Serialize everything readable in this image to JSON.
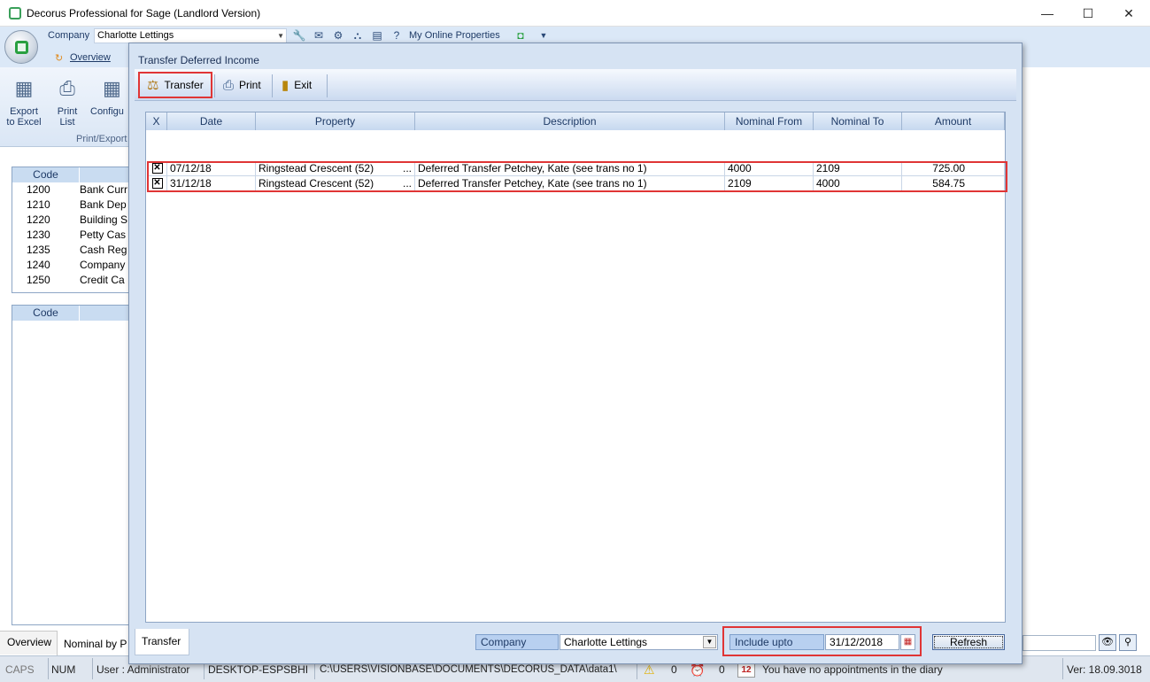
{
  "window": {
    "title": "Decorus Professional  for Sage (Landlord Version)",
    "min": "—",
    "max": "☐",
    "close": "✕"
  },
  "ribbon": {
    "company_label": "Company",
    "company_value": "Charlotte Lettings",
    "online_properties": "My Online Properties",
    "overview_tab": "Overview",
    "buttons": [
      {
        "label": "Export\nto Excel"
      },
      {
        "label": "Print\nList"
      },
      {
        "label": "Configu"
      }
    ],
    "group_label": "Print/Export"
  },
  "bg_list1": {
    "headers": [
      "Code",
      ""
    ],
    "rows": [
      {
        "code": "1200",
        "name": "Bank Curr"
      },
      {
        "code": "1210",
        "name": "Bank Dep"
      },
      {
        "code": "1220",
        "name": "Building S"
      },
      {
        "code": "1230",
        "name": "Petty Cas"
      },
      {
        "code": "1235",
        "name": "Cash Reg"
      },
      {
        "code": "1240",
        "name": "Company"
      },
      {
        "code": "1250",
        "name": "Credit Ca"
      }
    ]
  },
  "bg_list2": {
    "headers": [
      "Code",
      ""
    ]
  },
  "bottom_tabs": [
    "Overview",
    "Nominal by P"
  ],
  "dialog": {
    "title": "Transfer Deferred Income",
    "toolbar": {
      "transfer": "Transfer",
      "print": "Print",
      "exit": "Exit"
    },
    "columns": [
      "X",
      "Date",
      "Property",
      "Description",
      "Nominal From",
      "Nominal To",
      "Amount"
    ],
    "rows": [
      {
        "checked": "✕",
        "date": "07/12/18",
        "property": "Ringstead Crescent (52)",
        "ellipsis": "...",
        "description": "Deferred Transfer Petchey, Kate (see trans no 1)",
        "nominal_from": "4000",
        "nominal_to": "2109",
        "amount": "725.00"
      },
      {
        "checked": "✕",
        "date": "31/12/18",
        "property": "Ringstead Crescent (52)",
        "ellipsis": "...",
        "description": "Deferred Transfer Petchey, Kate (see trans no 1)",
        "nominal_from": "2109",
        "nominal_to": "4000",
        "amount": "584.75"
      }
    ],
    "tab_label": "Transfer",
    "company_label": "Company",
    "company_value": "Charlotte Lettings",
    "include_label": "Include upto",
    "include_value": "31/12/2018",
    "refresh": "Refresh"
  },
  "status": {
    "caps": "CAPS",
    "num": "NUM",
    "user": "User : Administrator",
    "machine": "DESKTOP-ESPSBHI",
    "path": "C:\\USERS\\VISIONBASE\\DOCUMENTS\\DECORUS_DATA\\data1\\",
    "warn_count": "0",
    "alarm_count": "0",
    "calendar_day": "12",
    "appointments": "You have no appointments in the diary",
    "version": "Ver: 18.09.3018"
  },
  "colors": {
    "highlight": "#e03535",
    "accent": "#1e3a66"
  }
}
